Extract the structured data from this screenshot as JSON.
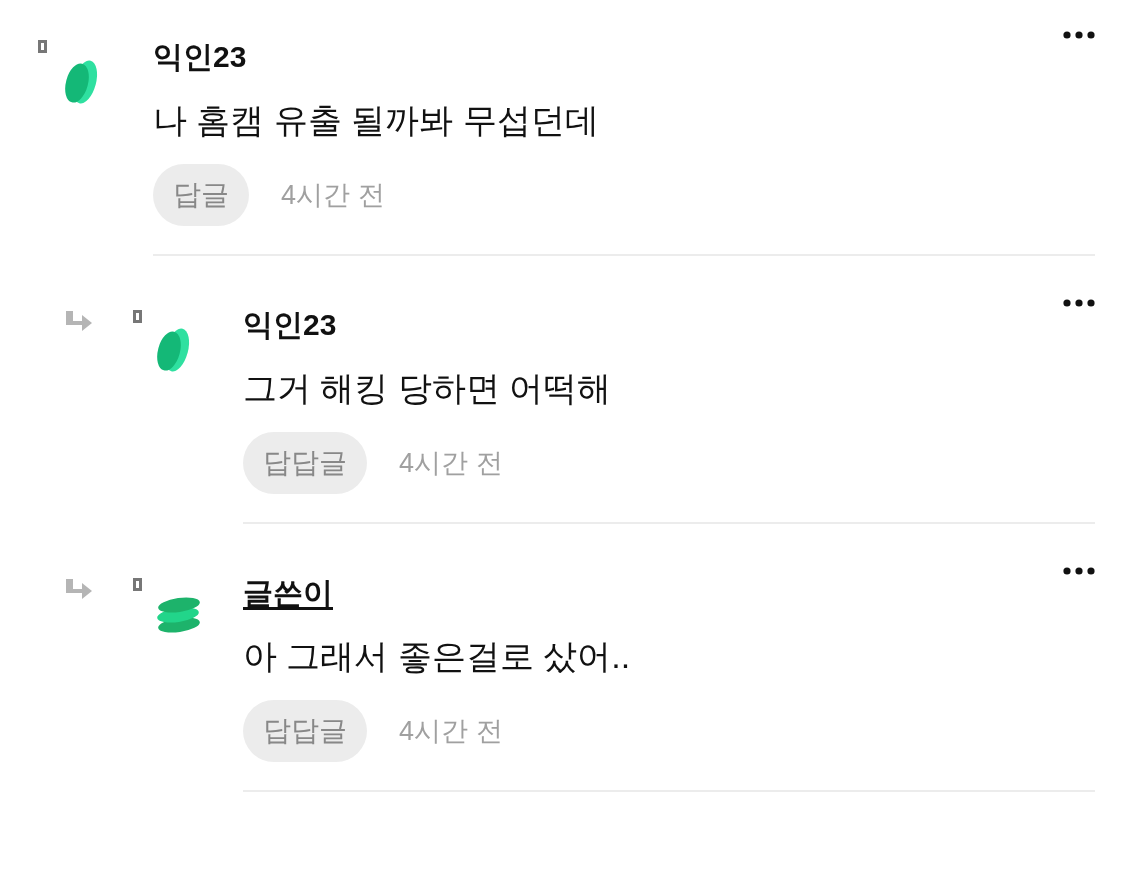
{
  "comments": [
    {
      "author": "익인23",
      "is_author": false,
      "text": "나 홈캠 유출 될까봐 무섭던데",
      "reply_button": "답글",
      "time": "4시간 전",
      "children": [
        {
          "author": "익인23",
          "is_author": false,
          "text": "그거 해킹 당하면 어떡해",
          "reply_button": "답답글",
          "time": "4시간 전"
        },
        {
          "author": "글쓴이",
          "is_author": true,
          "text": "아 그래서 좋은걸로 샀어..",
          "reply_button": "답답글",
          "time": "4시간 전"
        }
      ]
    }
  ]
}
